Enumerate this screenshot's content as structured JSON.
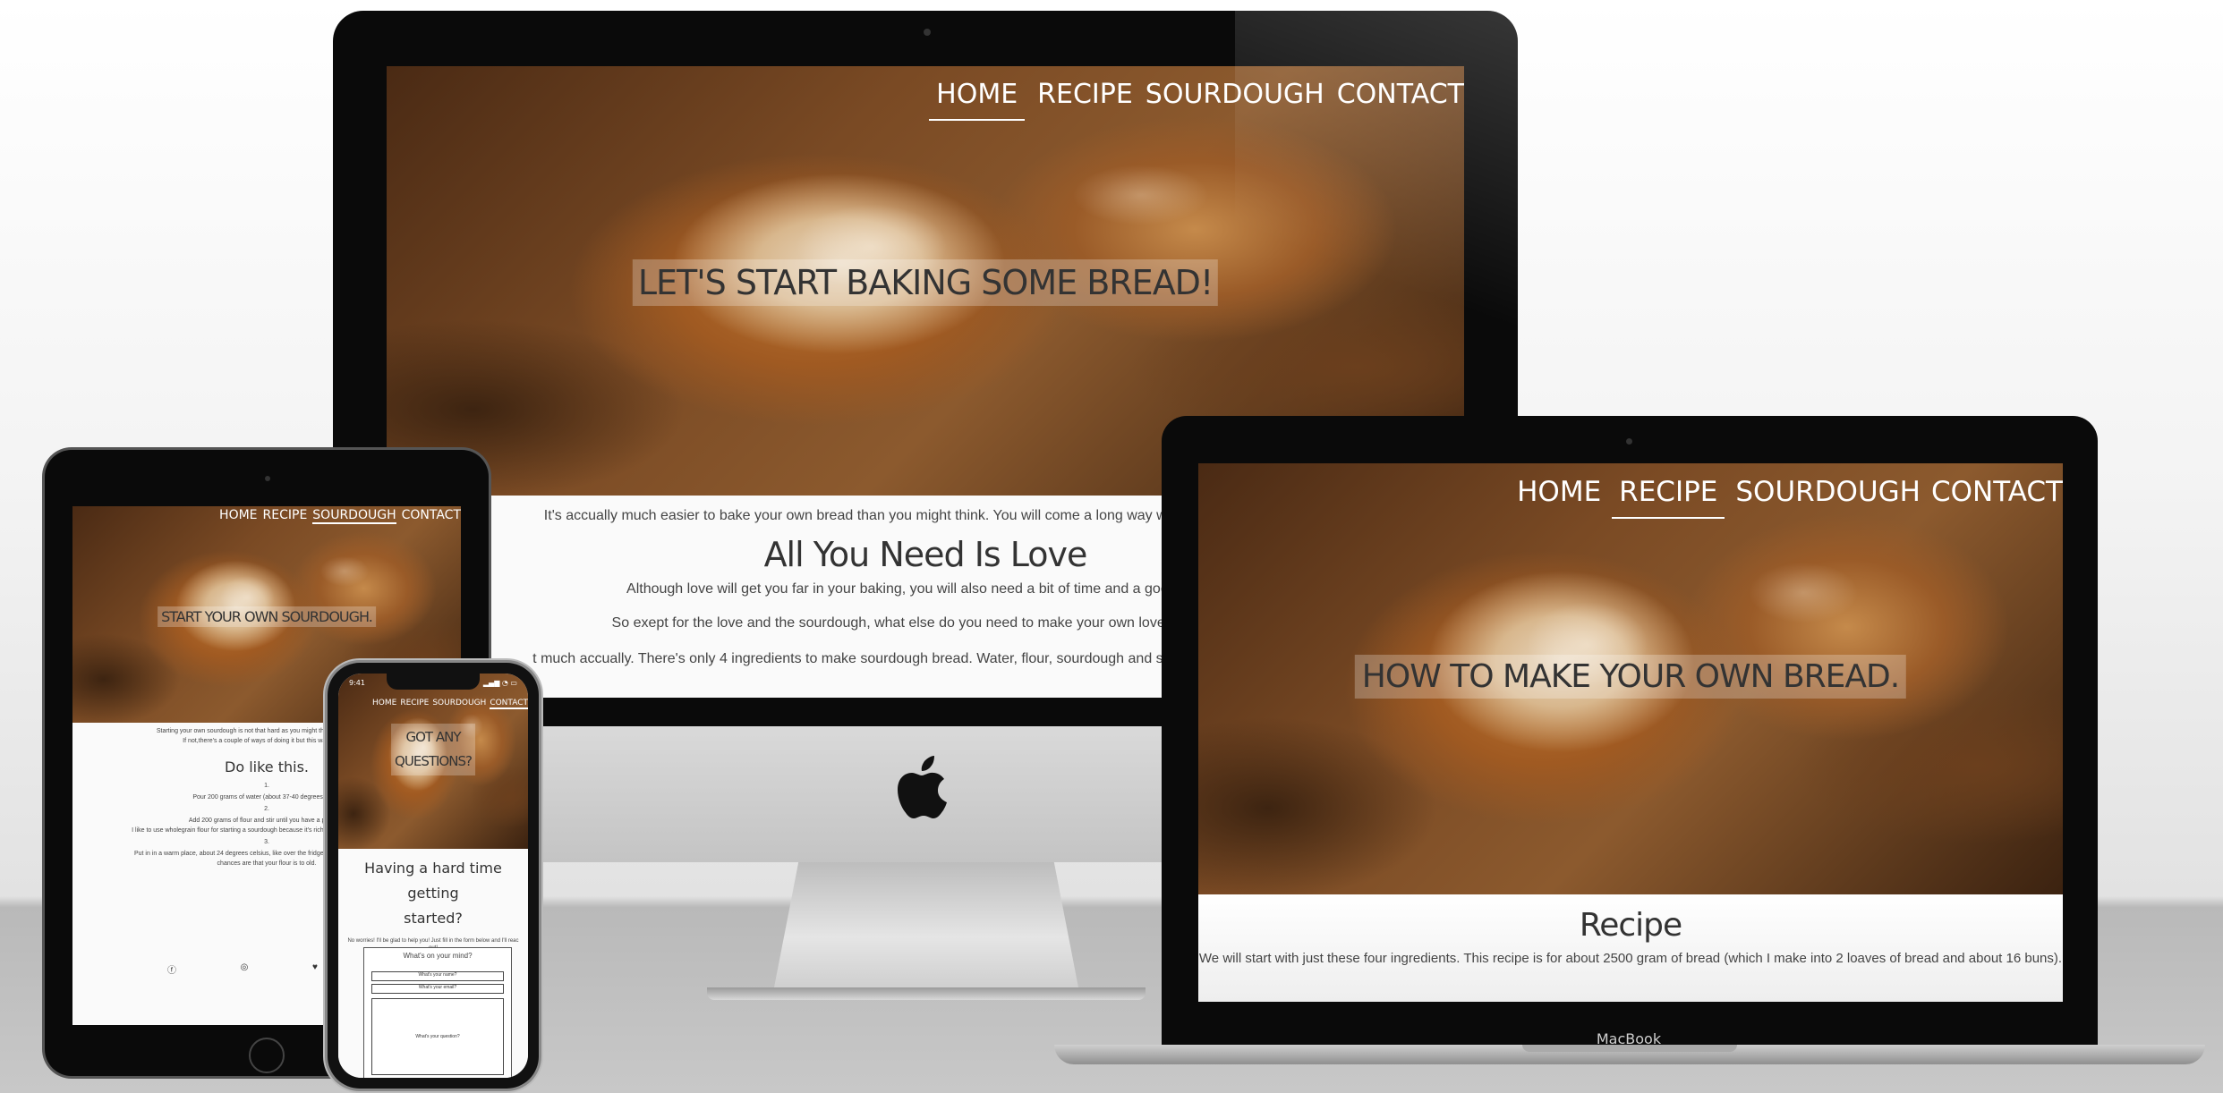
{
  "imac": {
    "nav": [
      "HOME",
      "RECIPE",
      "SOURDOUGH",
      "CONTACT"
    ],
    "hero": "LET'S START BAKING SOME BREAD!",
    "intro": "It's accually much easier to bake your own bread than you might think. You will come a long way with only the love of bre",
    "heading": "All You Need Is Love",
    "p1": "Although love will get you far in your baking, you will also need a bit of time and a good sourdo",
    "p2": "So exept for the love and the sourdough, what else do you need to make your own lovely sourdoug",
    "p3": "t much accually. There's only 4 ingredients to make sourdough bread. Water, flour, sourdough and salt. To get you on your w"
  },
  "macbook": {
    "nav": [
      "HOME",
      "RECIPE",
      "SOURDOUGH",
      "CONTACT"
    ],
    "hero": "HOW TO MAKE YOUR OWN BREAD.",
    "heading": "Recipe",
    "p1": "We will start with just these four ingredients. This recipe is for about 2500 gram of bread (which I make into 2 loaves of bread and about 16 buns).",
    "label": "MacBook"
  },
  "ipad": {
    "nav": [
      "HOME",
      "RECIPE",
      "SOURDOUGH",
      "CONTACT"
    ],
    "hero": "START YOUR OWN SOURDOUGH.",
    "p1": "Starting your own sourdough is not that hard as you might think. If you have a fr",
    "p2": "If not,there's a couple of ways of doing it but this way has wo",
    "heading": "Do like this.",
    "steps": [
      {
        "num": "1.",
        "text": "Pour 200 grams of water (about 37-40 degrees celsiu"
      },
      {
        "num": "2.",
        "text": "Add 200 grams of flour and stir until you have a porridge"
      },
      {
        "num": "",
        "text": "I like to use wholegrain flour for starting a sourdough because it's rich with microorganisms and m"
      },
      {
        "num": "3.",
        "text": "Put in in a warm place, about 24 degrees celsius, like over the fridge. After about 12- 24 hours y"
      },
      {
        "num": "",
        "text": "chances are that your flour is to old."
      }
    ],
    "social_icons": [
      "facebook-icon",
      "instagram-icon",
      "twitter-icon"
    ]
  },
  "iphone": {
    "time": "9:41",
    "nav": [
      "HOME",
      "RECIPE",
      "SOURDOUGH",
      "CONTACT"
    ],
    "hero_line1": "GOT ANY",
    "hero_line2": "QUESTIONS?",
    "heading_line1": "Having a hard time getting",
    "heading_line2": "started?",
    "p1": "No worries! I'll be glad to help you! Just fill in the form below and I'll reac",
    "p2": "out!",
    "form_title": "What's on your mind?",
    "name_placeholder": "What's your name?",
    "email_placeholder": "What's your email?",
    "question_placeholder": "What's your question?"
  },
  "colors": {
    "screen_bg": "#fafafa",
    "bezel": "#0a0a0a",
    "text": "#444444"
  }
}
